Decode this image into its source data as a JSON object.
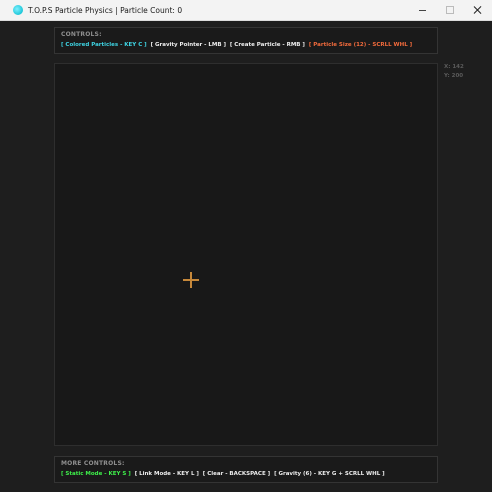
{
  "window": {
    "title": "T.O.P.S Particle Physics | Particle Count: 0",
    "icon": "particle-app-icon",
    "accent": "#1cc6d8"
  },
  "controls": {
    "label": "CONTROLS:",
    "items": [
      {
        "text": "[ Colored Particles - KEY C ]",
        "color": "#3ed3e2"
      },
      {
        "text": "[ Gravity Pointer - LMB ]",
        "color": "#eeeeee"
      },
      {
        "text": "[ Create Particle - RMB ]",
        "color": "#eeeeee"
      },
      {
        "text": "[ Particle Size (12) - SCRLL WHL ]",
        "color": "#f26b3c"
      }
    ]
  },
  "more_controls": {
    "label": "MORE CONTROLS:",
    "items": [
      {
        "text": "[ Static Mode - KEY S ]",
        "color": "#3ef04a"
      },
      {
        "text": "[ Link Mode - KEY L ]",
        "color": "#eeeeee"
      },
      {
        "text": "[ Clear - BACKSPACE ]",
        "color": "#eeeeee"
      },
      {
        "text": "[ Gravity (6) - KEY G + SCRLL WHL ]",
        "color": "#eeeeee"
      }
    ]
  },
  "coords": {
    "x": "X: 142",
    "y": "Y: 200"
  },
  "cursor": {
    "icon": "crosshair-icon",
    "color": "#c6883a"
  }
}
